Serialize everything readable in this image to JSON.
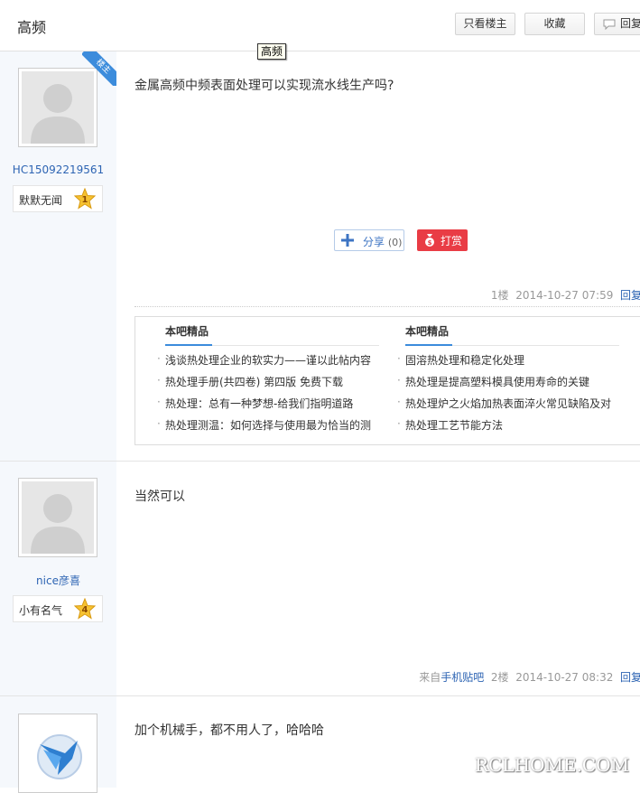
{
  "header": {
    "title": "高频",
    "buttons": {
      "only_op": "只看楼主",
      "favorite": "收藏",
      "reply": "回复"
    }
  },
  "tooltip": "高频",
  "posts": [
    {
      "username": "HC15092219561",
      "level_name": "默默无闻",
      "level_num": "1",
      "badge": "楼主",
      "content": "金属高频中频表面处理可以实现流水线生产吗?",
      "share_label": "分享",
      "share_count": "(0)",
      "reward_label": "打赏",
      "floor": "1楼",
      "time": "2014-10-27 07:59",
      "reply": "回复"
    },
    {
      "username": "nice彦喜",
      "level_name": "小有名气",
      "level_num": "4",
      "content": "当然可以",
      "source_prefix": "来自",
      "source_link": "手机贴吧",
      "floor": "2楼",
      "time": "2014-10-27 08:32",
      "reply": "回复"
    },
    {
      "content": "加个机械手，都不用人了，哈哈哈"
    }
  ],
  "jingpin": {
    "left": {
      "heading": "本吧精品",
      "items": [
        "浅谈热处理企业的软实力——谨以此帖内容",
        "热处理手册(共四卷) 第四版 免费下载",
        "热处理：总有一种梦想-给我们指明道路",
        "热处理测温：如何选择与使用最为恰当的测"
      ]
    },
    "right": {
      "heading": "本吧精品",
      "items": [
        "固溶热处理和稳定化处理",
        "热处理是提高塑料模具使用寿命的关键",
        "热处理炉之火焰加热表面淬火常见缺陷及对",
        "热处理工艺节能方法"
      ]
    }
  },
  "watermark": "RCLHOME.COM",
  "colors": {
    "link": "#2d64b3",
    "badge_blue": "#3c8cdc",
    "reward_red": "#e93c45",
    "sidebar_bg": "#f5f8fc"
  }
}
